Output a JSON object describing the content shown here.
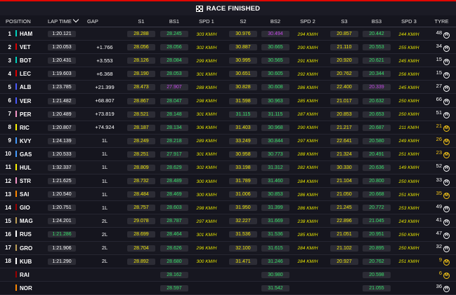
{
  "banner": {
    "title": "RACE FINISHED",
    "icon": "chequered-flag-icon"
  },
  "columns": {
    "position": "POSITION",
    "lap_time": "LAP TIME",
    "gap": "GAP",
    "s1": "S1",
    "bs1": "BS1",
    "spd1": "SPD 1",
    "s2": "S2",
    "bs2": "BS2",
    "spd2": "SPD 2",
    "s3": "S3",
    "bs3": "BS3",
    "spd3": "SPD 3",
    "tyre": "TYRE"
  },
  "colors": {
    "yellow": "#f0e70c",
    "green": "#39e06a",
    "purple": "#c44ae6",
    "medium_tyre": "#f5c518"
  },
  "rows": [
    {
      "pos": "1",
      "name": "HAM",
      "team": "#00d2be",
      "lap": "1:20.121",
      "lap_c": "w",
      "gap": "",
      "s1": "28.288",
      "s1c": "y",
      "bs1": "28.245",
      "bs1c": "g",
      "spd1": "303 KM/H",
      "spd1c": "y",
      "s2": "30.976",
      "s2c": "y",
      "bs2": "30.494",
      "bs2c": "p",
      "spd2": "294 KM/H",
      "spd2c": "y",
      "s3": "20.857",
      "s3c": "y",
      "bs3": "20.442",
      "bs3c": "g",
      "spd3": "244 KM/H",
      "spd3c": "y",
      "tl": "48",
      "tlc": "w",
      "tt": "H"
    },
    {
      "pos": "2",
      "name": "VET",
      "team": "#dc0000",
      "lap": "1:20.053",
      "lap_c": "w",
      "gap": "+1.766",
      "s1": "28.056",
      "s1c": "y",
      "bs1": "28.056",
      "bs1c": "g",
      "spd1": "302 KM/H",
      "spd1c": "y",
      "s2": "30.887",
      "s2c": "y",
      "bs2": "30.665",
      "bs2c": "g",
      "spd2": "290 KM/H",
      "spd2c": "y",
      "s3": "21.110",
      "s3c": "y",
      "bs3": "20.553",
      "bs3c": "g",
      "spd3": "255 KM/H",
      "spd3c": "y",
      "tl": "34",
      "tlc": "w",
      "tt": "H"
    },
    {
      "pos": "3",
      "name": "BOT",
      "team": "#00d2be",
      "lap": "1:20.431",
      "lap_c": "w",
      "gap": "+3.553",
      "s1": "28.126",
      "s1c": "y",
      "bs1": "28.084",
      "bs1c": "g",
      "spd1": "299 KM/H",
      "spd1c": "y",
      "s2": "30.995",
      "s2c": "y",
      "bs2": "30.565",
      "bs2c": "g",
      "spd2": "291 KM/H",
      "spd2c": "y",
      "s3": "20.920",
      "s3c": "y",
      "bs3": "20.621",
      "bs3c": "g",
      "spd3": "245 KM/H",
      "spd3c": "y",
      "tl": "15",
      "tlc": "w",
      "tt": "H"
    },
    {
      "pos": "4",
      "name": "LEC",
      "team": "#dc0000",
      "lap": "1:19.603",
      "lap_c": "w",
      "gap": "+6.368",
      "s1": "28.190",
      "s1c": "y",
      "bs1": "28.053",
      "bs1c": "g",
      "spd1": "301 KM/H",
      "spd1c": "y",
      "s2": "30.651",
      "s2c": "y",
      "bs2": "30.605",
      "bs2c": "g",
      "spd2": "292 KM/H",
      "spd2c": "y",
      "s3": "20.762",
      "s3c": "y",
      "bs3": "20.344",
      "bs3c": "g",
      "spd3": "256 KM/H",
      "spd3c": "y",
      "tl": "15",
      "tlc": "w",
      "tt": "H"
    },
    {
      "pos": "5",
      "name": "ALB",
      "team": "#4a5aff",
      "lap": "1:23.785",
      "lap_c": "w",
      "gap": "+21.399",
      "s1": "28.473",
      "s1c": "y",
      "bs1": "27.907",
      "bs1c": "p",
      "spd1": "288 KM/H",
      "spd1c": "y",
      "s2": "30.828",
      "s2c": "y",
      "bs2": "30.608",
      "bs2c": "g",
      "spd2": "286 KM/H",
      "spd2c": "y",
      "s3": "22.400",
      "s3c": "y",
      "bs3": "20.339",
      "bs3c": "p",
      "spd3": "245 KM/H",
      "spd3c": "y",
      "tl": "27",
      "tlc": "w",
      "tt": "H"
    },
    {
      "pos": "6",
      "name": "VER",
      "team": "#4a5aff",
      "lap": "1:21.482",
      "lap_c": "w",
      "gap": "+68.807",
      "s1": "28.867",
      "s1c": "y",
      "bs1": "28.047",
      "bs1c": "g",
      "spd1": "298 KM/H",
      "spd1c": "y",
      "s2": "31.598",
      "s2c": "y",
      "bs2": "30.963",
      "bs2c": "g",
      "spd2": "285 KM/H",
      "spd2c": "y",
      "s3": "21.017",
      "s3c": "y",
      "bs3": "20.632",
      "bs3c": "g",
      "spd3": "250 KM/H",
      "spd3c": "y",
      "tl": "66",
      "tlc": "w",
      "tt": "H"
    },
    {
      "pos": "7",
      "name": "PER",
      "team": "#f596c8",
      "lap": "1:20.489",
      "lap_c": "w",
      "gap": "+73.819",
      "s1": "28.521",
      "s1c": "y",
      "bs1": "28.148",
      "bs1c": "g",
      "spd1": "301 KM/H",
      "spd1c": "y",
      "s2": "31.115",
      "s2c": "g",
      "bs2": "31.115",
      "bs2c": "g",
      "spd2": "287 KM/H",
      "spd2c": "y",
      "s3": "20.853",
      "s3c": "y",
      "bs3": "20.653",
      "bs3c": "g",
      "spd3": "250 KM/H",
      "spd3c": "y",
      "tl": "51",
      "tlc": "w",
      "tt": "H"
    },
    {
      "pos": "8",
      "name": "RIC",
      "team": "#fff500",
      "lap": "1:20.807",
      "lap_c": "w",
      "gap": "+74.924",
      "s1": "28.187",
      "s1c": "y",
      "bs1": "28.134",
      "bs1c": "g",
      "spd1": "306 KM/H",
      "spd1c": "y",
      "s2": "31.403",
      "s2c": "y",
      "bs2": "30.968",
      "bs2c": "g",
      "spd2": "290 KM/H",
      "spd2c": "y",
      "s3": "21.217",
      "s3c": "y",
      "bs3": "20.687",
      "bs3c": "g",
      "spd3": "211 KM/H",
      "spd3c": "y",
      "tl": "21",
      "tlc": "y",
      "tt": "M"
    },
    {
      "pos": "9",
      "name": "KVY",
      "team": "#469bff",
      "lap": "1:24.139",
      "lap_c": "w",
      "gap": "1L",
      "s1": "28.249",
      "s1c": "y",
      "bs1": "28.218",
      "bs1c": "g",
      "spd1": "289 KM/H",
      "spd1c": "y",
      "s2": "33.249",
      "s2c": "y",
      "bs2": "30.844",
      "bs2c": "g",
      "spd2": "297 KM/H",
      "spd2c": "y",
      "s3": "22.641",
      "s3c": "y",
      "bs3": "20.580",
      "bs3c": "g",
      "spd3": "249 KM/H",
      "spd3c": "y",
      "tl": "26",
      "tlc": "y",
      "tt": "M"
    },
    {
      "pos": "10",
      "name": "GAS",
      "team": "#469bff",
      "lap": "1:20.533",
      "lap_c": "w",
      "gap": "1L",
      "s1": "28.251",
      "s1c": "y",
      "bs1": "27.917",
      "bs1c": "g",
      "spd1": "301 KM/H",
      "spd1c": "y",
      "s2": "30.958",
      "s2c": "y",
      "bs2": "30.773",
      "bs2c": "g",
      "spd2": "288 KM/H",
      "spd2c": "y",
      "s3": "21.324",
      "s3c": "y",
      "bs3": "20.491",
      "bs3c": "g",
      "spd3": "251 KM/H",
      "spd3c": "y",
      "tl": "23",
      "tlc": "y",
      "tt": "M"
    },
    {
      "pos": "11",
      "name": "HUL",
      "team": "#fff500",
      "lap": "1:32.337",
      "lap_c": "w",
      "gap": "1L",
      "s1": "28.809",
      "s1c": "y",
      "bs1": "28.629",
      "bs1c": "g",
      "spd1": "302 KM/H",
      "spd1c": "y",
      "s2": "33.198",
      "s2c": "y",
      "bs2": "31.312",
      "bs2c": "g",
      "spd2": "282 KM/H",
      "spd2c": "y",
      "s3": "30.330",
      "s3c": "y",
      "bs3": "20.636",
      "bs3c": "g",
      "spd3": "149 KM/H",
      "spd3c": "y",
      "tl": "52",
      "tlc": "w",
      "tt": "H"
    },
    {
      "pos": "12",
      "name": "STR",
      "team": "#f596c8",
      "lap": "1:21.625",
      "lap_c": "w",
      "gap": "1L",
      "s1": "28.732",
      "s1c": "y",
      "bs1": "28.489",
      "bs1c": "g",
      "spd1": "300 KM/H",
      "spd1c": "y",
      "s2": "31.789",
      "s2c": "y",
      "bs2": "31.460",
      "bs2c": "g",
      "spd2": "284 KM/H",
      "spd2c": "y",
      "s3": "21.104",
      "s3c": "y",
      "bs3": "20.800",
      "bs3c": "g",
      "spd3": "250 KM/H",
      "spd3c": "y",
      "tl": "33",
      "tlc": "w",
      "tt": "H"
    },
    {
      "pos": "13",
      "name": "SAI",
      "team": "#ff8700",
      "lap": "1:20.540",
      "lap_c": "w",
      "gap": "1L",
      "s1": "28.484",
      "s1c": "y",
      "bs1": "28.469",
      "bs1c": "g",
      "spd1": "300 KM/H",
      "spd1c": "y",
      "s2": "31.006",
      "s2c": "y",
      "bs2": "30.853",
      "bs2c": "g",
      "spd2": "286 KM/H",
      "spd2c": "y",
      "s3": "21.050",
      "s3c": "y",
      "bs3": "20.668",
      "bs3c": "g",
      "spd3": "251 KM/H",
      "spd3c": "y",
      "tl": "35",
      "tlc": "y",
      "tt": "M"
    },
    {
      "pos": "14",
      "name": "GIO",
      "team": "#9b0000",
      "lap": "1:20.751",
      "lap_c": "w",
      "gap": "1L",
      "s1": "28.757",
      "s1c": "y",
      "bs1": "28.603",
      "bs1c": "g",
      "spd1": "298 KM/H",
      "spd1c": "y",
      "s2": "31.950",
      "s2c": "y",
      "bs2": "31.399",
      "bs2c": "g",
      "spd2": "286 KM/H",
      "spd2c": "y",
      "s3": "21.245",
      "s3c": "y",
      "bs3": "20.772",
      "bs3c": "g",
      "spd3": "253 KM/H",
      "spd3c": "y",
      "tl": "49",
      "tlc": "w",
      "tt": "H"
    },
    {
      "pos": "15",
      "name": "MAG",
      "team": "#bd9e57",
      "lap": "1:24.201",
      "lap_c": "w",
      "gap": "2L",
      "s1": "29.078",
      "s1c": "y",
      "bs1": "28.787",
      "bs1c": "g",
      "spd1": "297 KM/H",
      "spd1c": "y",
      "s2": "32.227",
      "s2c": "y",
      "bs2": "31.669",
      "bs2c": "g",
      "spd2": "238 KM/H",
      "spd2c": "y",
      "s3": "22.896",
      "s3c": "y",
      "bs3": "21.045",
      "bs3c": "g",
      "spd3": "243 KM/H",
      "spd3c": "y",
      "tl": "41",
      "tlc": "w",
      "tt": "H"
    },
    {
      "pos": "16",
      "name": "RUS",
      "team": "#ffffff",
      "lap": "1:21.286",
      "lap_c": "g",
      "gap": "2L",
      "s1": "28.699",
      "s1c": "y",
      "bs1": "28.464",
      "bs1c": "g",
      "spd1": "301 KM/H",
      "spd1c": "y",
      "s2": "31.536",
      "s2c": "y",
      "bs2": "31.536",
      "bs2c": "g",
      "spd2": "285 KM/H",
      "spd2c": "y",
      "s3": "21.051",
      "s3c": "y",
      "bs3": "20.951",
      "bs3c": "g",
      "spd3": "250 KM/H",
      "spd3c": "y",
      "tl": "47",
      "tlc": "w",
      "tt": "H"
    },
    {
      "pos": "17",
      "name": "GRO",
      "team": "#bd9e57",
      "lap": "1:21.906",
      "lap_c": "w",
      "gap": "2L",
      "s1": "28.704",
      "s1c": "y",
      "bs1": "28.626",
      "bs1c": "g",
      "spd1": "296 KM/H",
      "spd1c": "y",
      "s2": "32.100",
      "s2c": "y",
      "bs2": "31.615",
      "bs2c": "g",
      "spd2": "284 KM/H",
      "spd2c": "y",
      "s3": "21.102",
      "s3c": "y",
      "bs3": "20.895",
      "bs3c": "g",
      "spd3": "250 KM/H",
      "spd3c": "y",
      "tl": "32",
      "tlc": "w",
      "tt": "H"
    },
    {
      "pos": "18",
      "name": "KUB",
      "team": "#ffffff",
      "lap": "1:21.290",
      "lap_c": "w",
      "gap": "2L",
      "s1": "28.892",
      "s1c": "y",
      "bs1": "28.680",
      "bs1c": "g",
      "spd1": "300 KM/H",
      "spd1c": "y",
      "s2": "31.471",
      "s2c": "y",
      "bs2": "31.246",
      "bs2c": "g",
      "spd2": "284 KM/H",
      "spd2c": "y",
      "s3": "20.927",
      "s3c": "y",
      "bs3": "20.762",
      "bs3c": "g",
      "spd3": "251 KM/H",
      "spd3c": "y",
      "tl": "9",
      "tlc": "y",
      "tt": "M"
    },
    {
      "pos": "",
      "name": "RAI",
      "team": "#9b0000",
      "lap": "",
      "lap_c": "w",
      "gap": "",
      "s1": "",
      "s1c": "y",
      "bs1": "28.162",
      "bs1c": "g",
      "spd1": "",
      "spd1c": "y",
      "s2": "",
      "s2c": "y",
      "bs2": "30.980",
      "bs2c": "g",
      "spd2": "",
      "spd2c": "y",
      "s3": "",
      "s3c": "y",
      "bs3": "20.598",
      "bs3c": "g",
      "spd3": "",
      "spd3c": "y",
      "tl": "6",
      "tlc": "y",
      "tt": "M"
    },
    {
      "pos": "",
      "name": "NOR",
      "team": "#ff8700",
      "lap": "",
      "lap_c": "w",
      "gap": "",
      "s1": "",
      "s1c": "y",
      "bs1": "28.597",
      "bs1c": "g",
      "spd1": "",
      "spd1c": "y",
      "s2": "",
      "s2c": "y",
      "bs2": "31.542",
      "bs2c": "g",
      "spd2": "",
      "spd2c": "y",
      "s3": "",
      "s3c": "y",
      "bs3": "21.055",
      "bs3c": "g",
      "spd3": "",
      "spd3c": "y",
      "tl": "36",
      "tlc": "w",
      "tt": "H"
    }
  ]
}
